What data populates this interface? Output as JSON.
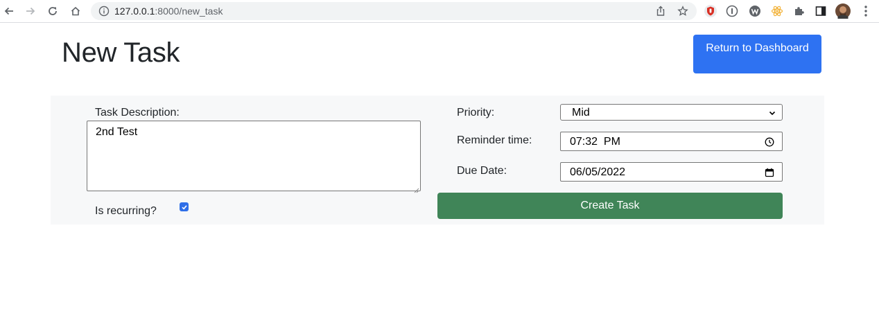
{
  "browser": {
    "url_host": "127.0.0.1",
    "url_rest": ":8000/new_task",
    "icons": [
      "back-arrow-icon",
      "forward-arrow-icon",
      "reload-icon",
      "home-icon",
      "site-info-icon",
      "share-icon",
      "bookmark-star-icon",
      "extension-shield-icon",
      "extension-info-icon",
      "extension-w-icon",
      "extension-atom-icon",
      "extensions-puzzle-icon",
      "side-panel-icon",
      "profile-avatar",
      "menu-kebab-icon"
    ]
  },
  "header": {
    "title": "New Task",
    "dashboard_button": "Return to Dashboard"
  },
  "form": {
    "description_label": "Task Description:",
    "description_value": "2nd Test",
    "recurring_label": "Is recurring?",
    "recurring_checked": true,
    "priority_label": "Priority:",
    "priority_value": "Mid",
    "reminder_label": "Reminder time:",
    "reminder_value": "07:32  PM",
    "due_label": "Due Date:",
    "due_value": "06/05/2022",
    "submit_label": "Create Task"
  },
  "colors": {
    "primary_button": "#2e72f2",
    "success_button": "#408558",
    "panel_background": "#f7f8f9"
  }
}
